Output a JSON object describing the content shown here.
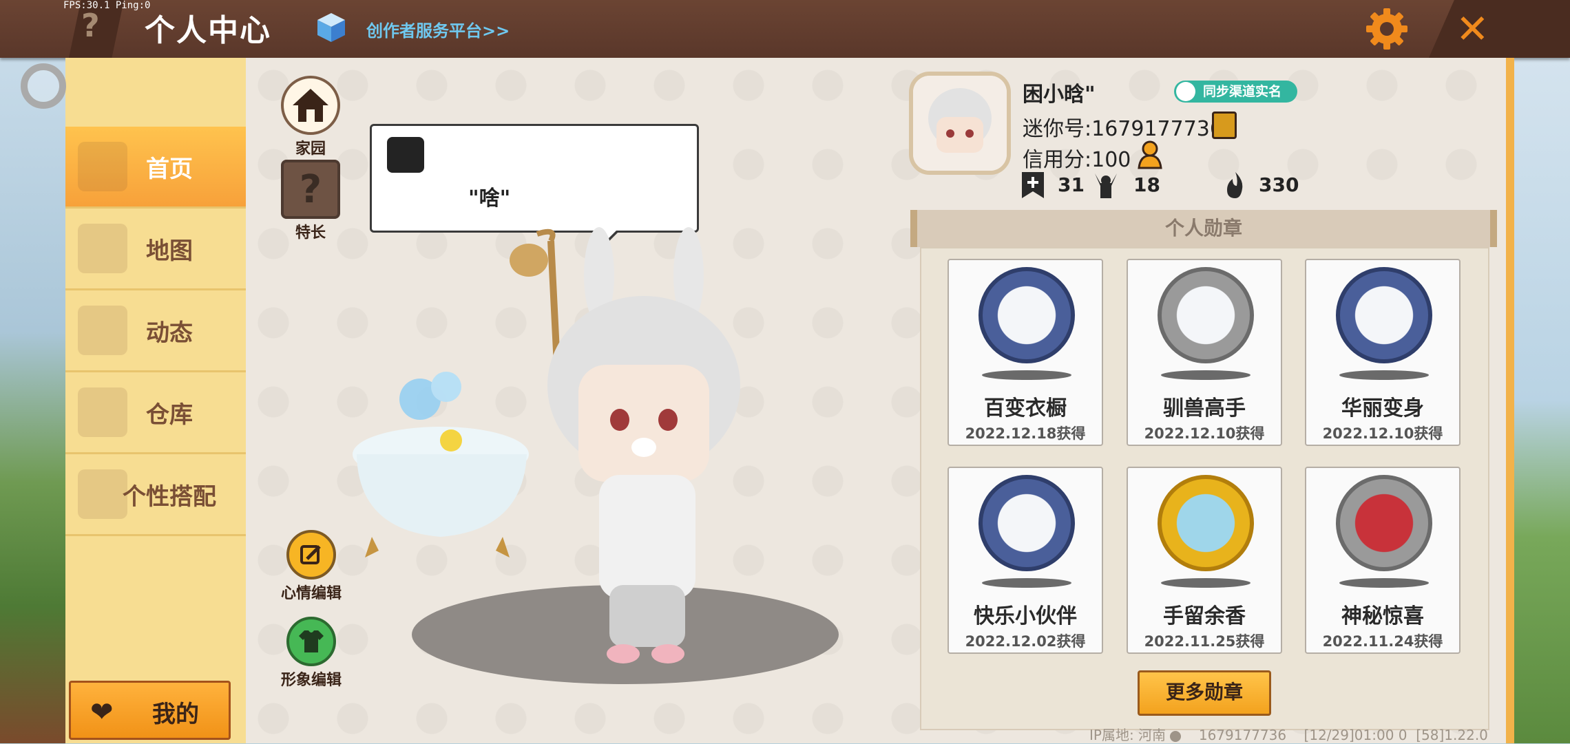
{
  "debug": {
    "fps_text": "FPS:30.1  Ping:0"
  },
  "header": {
    "help_icon": "question-icon",
    "title": "个人中心",
    "creator_link": "创作者服务平台>>",
    "settings_icon": "gear-icon",
    "close_icon": "close-icon"
  },
  "menu": {
    "items": [
      {
        "label": "首页",
        "icon": "home-icon",
        "active": true
      },
      {
        "label": "地图",
        "icon": "map-icon",
        "active": false
      },
      {
        "label": "动态",
        "icon": "bell-icon",
        "active": false
      },
      {
        "label": "仓库",
        "icon": "warehouse-icon",
        "active": false
      },
      {
        "label": "个性搭配",
        "icon": "outfit-icon",
        "active": false
      }
    ],
    "mine_label": "我的"
  },
  "side_buttons": {
    "home_label": "家园",
    "skill_label": "特长",
    "mood_label": "心情编辑",
    "look_label": "形象编辑"
  },
  "bubble": {
    "text": "\"啥\""
  },
  "profile": {
    "name": "困小晗\"",
    "sync_label": "同步渠道实名",
    "mini_id": "迷你号:1679177736",
    "credit": "信用分:100",
    "stats": {
      "adds": "31",
      "fans": "18",
      "heat": "330"
    }
  },
  "medals": {
    "title": "个人勋章",
    "items": [
      {
        "name": "百变衣橱",
        "date": "2022.12.18获得",
        "color": "#4a5f9a"
      },
      {
        "name": "驯兽高手",
        "date": "2022.12.10获得",
        "color": "#9a9a9a"
      },
      {
        "name": "华丽变身",
        "date": "2022.12.10获得",
        "color": "#4a5f9a"
      },
      {
        "name": "快乐小伙伴",
        "date": "2022.12.02获得",
        "color": "#4a5f9a"
      },
      {
        "name": "手留余香",
        "date": "2022.11.25获得",
        "color": "#e8b31c"
      },
      {
        "name": "神秘惊喜",
        "date": "2022.11.24获得",
        "color": "#9a9a9a"
      }
    ],
    "more_label": "更多勋章"
  },
  "footer": {
    "ip_location": "IP属地: 河南",
    "uid": "1679177736",
    "time": "[12/29]01:00 0",
    "version": "[58]1.22.0"
  }
}
